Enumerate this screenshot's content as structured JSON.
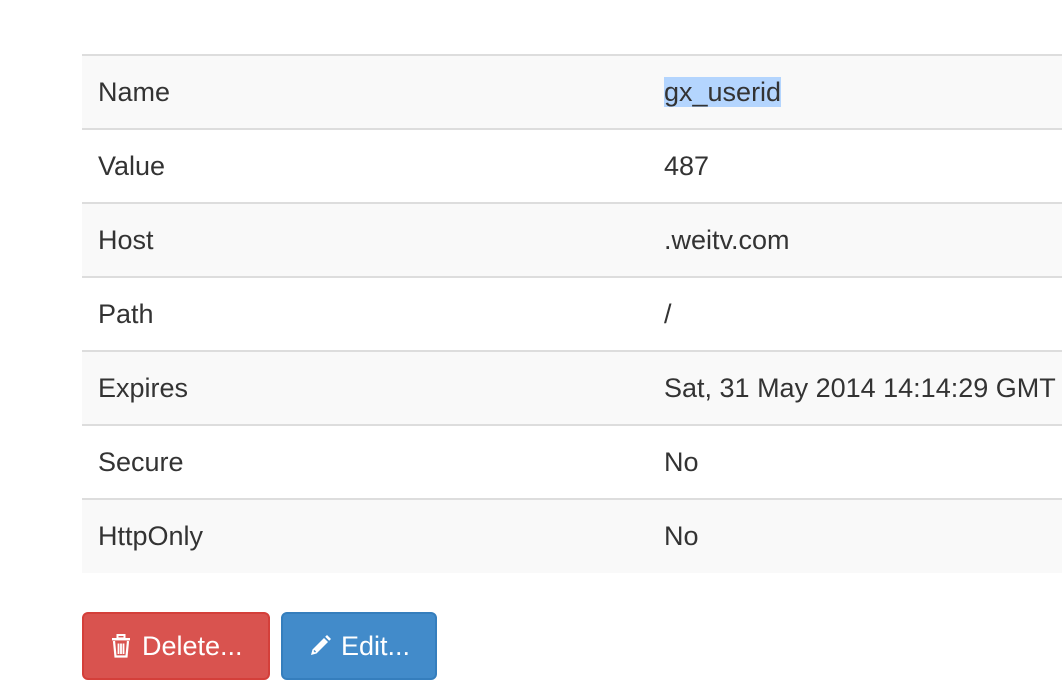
{
  "cookie": {
    "rows": [
      {
        "label": "Name",
        "value": "gx_userid"
      },
      {
        "label": "Value",
        "value": "487"
      },
      {
        "label": "Host",
        "value": ".weitv.com"
      },
      {
        "label": "Path",
        "value": "/"
      },
      {
        "label": "Expires",
        "value": "Sat, 31 May 2014 14:14:29 GMT"
      },
      {
        "label": "Secure",
        "value": "No"
      },
      {
        "label": "HttpOnly",
        "value": "No"
      }
    ]
  },
  "actions": {
    "delete_label": "Delete...",
    "delete_icon": "trash-icon",
    "edit_label": "Edit...",
    "edit_icon": "pencil-icon"
  },
  "colors": {
    "danger": "#d9534f",
    "primary": "#428bca",
    "selection": "#b4d5fe",
    "stripe": "#f9f9f9",
    "border": "#dddddd"
  }
}
